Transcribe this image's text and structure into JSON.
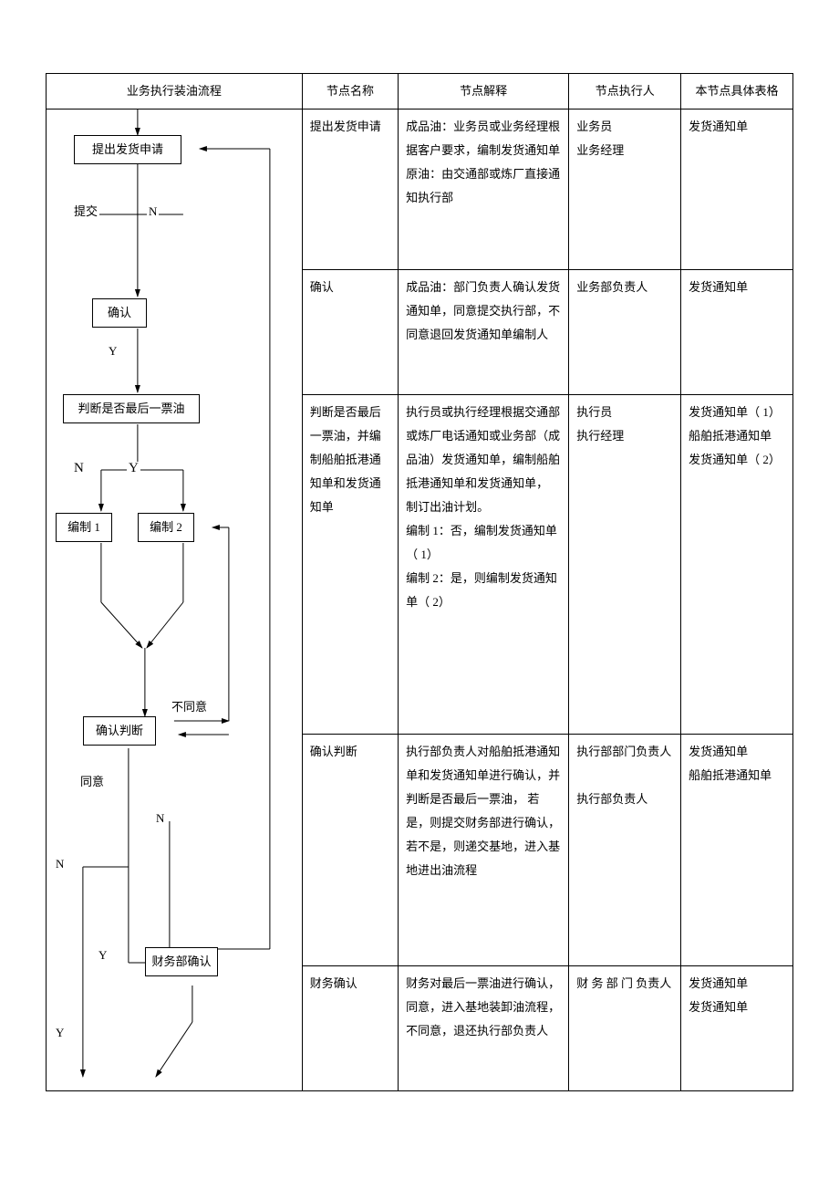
{
  "headers": {
    "flow": "业务执行装油流程",
    "node": "节点名称",
    "desc": "节点解释",
    "exec": "节点执行人",
    "form": "本节点具体表格"
  },
  "flowchart": {
    "box_apply": "提出发货申请",
    "box_confirm": "确认",
    "box_judge": "判断是否最后一票油",
    "box_compile1": "编制 1",
    "box_compile2": "编制 2",
    "box_confirm_judge": "确认判断",
    "box_finance": "财务部确认",
    "lbl_submit": "提交",
    "lbl_N1": "N",
    "lbl_Y1": "Y",
    "lbl_N2": "N",
    "lbl_Y2": "Y",
    "lbl_disagree": "不同意",
    "lbl_agree": "同意",
    "lbl_N3": "N",
    "lbl_N4": "N",
    "lbl_Y3": "Y",
    "lbl_Y4": "Y"
  },
  "rows": [
    {
      "node": "提出发货申请",
      "desc": "成品油：业务员或业务经理根据客户要求，编制发货通知单\n原油：由交通部或炼厂直接通知执行部",
      "exec": "业务员\n业务经理",
      "form": "发货通知单"
    },
    {
      "node": "确认",
      "desc": "成品油：部门负责人确认发货通知单，同意提交执行部，不同意退回发货通知单编制人",
      "exec": "业务部负责人",
      "form": "发货通知单"
    },
    {
      "node": "判断是否最后一票油，并编制船舶抵港通知单和发货通知单",
      "desc": "执行员或执行经理根据交通部或炼厂电话通知或业务部（成品油）发货通知单，编制船舶抵港通知单和发货通知单， 制订出油计划。\n编制 1：否，编制发货通知单（ 1）\n编制 2：是，则编制发货通知单（ 2）",
      "exec": "执行员\n执行经理",
      "form": "发货通知单（ 1）\n船舶抵港通知单\n发货通知单（ 2）"
    },
    {
      "node": "确认判断",
      "desc": "执行部负责人对船舶抵港通知单和发货通知单进行确认，并判断是否最后一票油， 若是，则提交财务部进行确认，若不是，则递交基地，进入基地进出油流程",
      "exec": "执行部部门负责人\n\n执行部负责人",
      "form": "发货通知单\n船舶抵港通知单"
    },
    {
      "node": "财务确认",
      "desc": "财务对最后一票油进行确认，同意，进入基地装卸油流程，不同意，退还执行部负责人",
      "exec": "财 务 部 门 负责人",
      "form": "发货通知单\n发货通知单"
    }
  ]
}
